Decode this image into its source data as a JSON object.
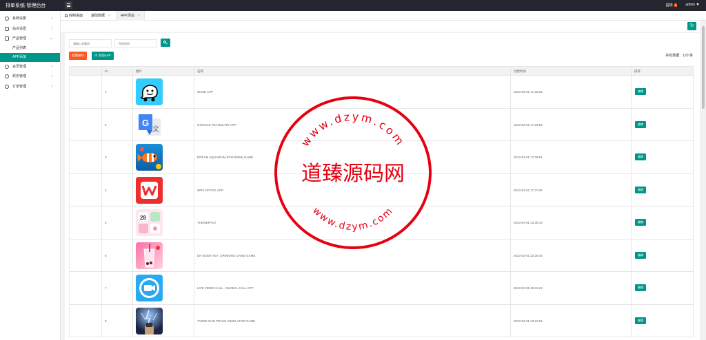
{
  "app": {
    "title": "排单系统-管理后台"
  },
  "header": {
    "msg_label": "提现",
    "msg_count": "1",
    "user": "admin"
  },
  "sidebar": {
    "items": [
      {
        "label": "系统设置",
        "icon": "gear-icon",
        "expanded": false
      },
      {
        "label": "站点设置",
        "icon": "cloud-icon",
        "expanded": false
      },
      {
        "label": "产品管理",
        "icon": "home-icon",
        "expanded": true
      },
      {
        "label": "会员管理",
        "icon": "user-icon",
        "expanded": false
      },
      {
        "label": "财务管理",
        "icon": "money-icon",
        "expanded": false
      },
      {
        "label": "订单管理",
        "icon": "order-icon",
        "expanded": false
      }
    ],
    "sub_items": [
      {
        "label": "产品列表",
        "active": false
      },
      {
        "label": "APP添加",
        "active": true
      }
    ]
  },
  "tabs": [
    {
      "label": "控制桌面"
    },
    {
      "label": "基础数据"
    },
    {
      "label": "APP添加"
    }
  ],
  "search": {
    "keyword_placeholder": "请输入关键词",
    "date_placeholder": "开始时间"
  },
  "toolbar": {
    "delete_label": "批量删除",
    "add_label": "添加APP",
    "total_label": "共有数据：",
    "total_value": "120",
    "total_unit": "条"
  },
  "table": {
    "headers": [
      "",
      "ID",
      "图片",
      "名称",
      "创建时间",
      "操作"
    ],
    "rows": [
      {
        "id": "1",
        "icon": "waze-icon",
        "name": "WAZE APP",
        "created": "2023-02-01 17:33:29",
        "action": "编辑"
      },
      {
        "id": "2",
        "icon": "google-translate-icon",
        "name": "GOOGLE TRANSLATE APP",
        "created": "2023-02-01 17:34:56",
        "action": "编辑"
      },
      {
        "id": "3",
        "icon": "dream-aquarium-icon",
        "name": "DREAM AQUARIUM (FISHDOM) GAME",
        "created": "2023-02-01 17:35:51",
        "action": "编辑"
      },
      {
        "id": "4",
        "icon": "wps-office-icon",
        "name": "WPS OFFICE APP",
        "created": "2023-02-01 17:37:25",
        "action": "编辑"
      },
      {
        "id": "5",
        "icon": "themepack-icon",
        "name": "THEMEPACK",
        "created": "2023-02-01 23:26:13",
        "action": "编辑"
      },
      {
        "id": "6",
        "icon": "boba-tea-icon",
        "name": "DIY BOBA TEA: DRINKING GAME GAME",
        "created": "2023-02-01 23:26:46",
        "action": "编辑"
      },
      {
        "id": "7",
        "icon": "live-video-call-icon",
        "name": "LIVE VIDEO CALL - GLOBAL CALL APP",
        "created": "2023-02-01 23:21:24",
        "action": "编辑"
      },
      {
        "id": "8",
        "icon": "taser-gun-icon",
        "name": "TASER GUN PRANK SIMULATOR GAME",
        "created": "2023-02-01 23:21:54",
        "action": "编辑"
      }
    ]
  },
  "watermark": {
    "main_text": "道臻源码网",
    "top_text": "www.dzym.com",
    "bottom_text": "www.dzym.com"
  },
  "colors": {
    "accent": "#009688",
    "danger": "#ff5722",
    "topbar": "#23262e",
    "stamp": "#e60012"
  }
}
